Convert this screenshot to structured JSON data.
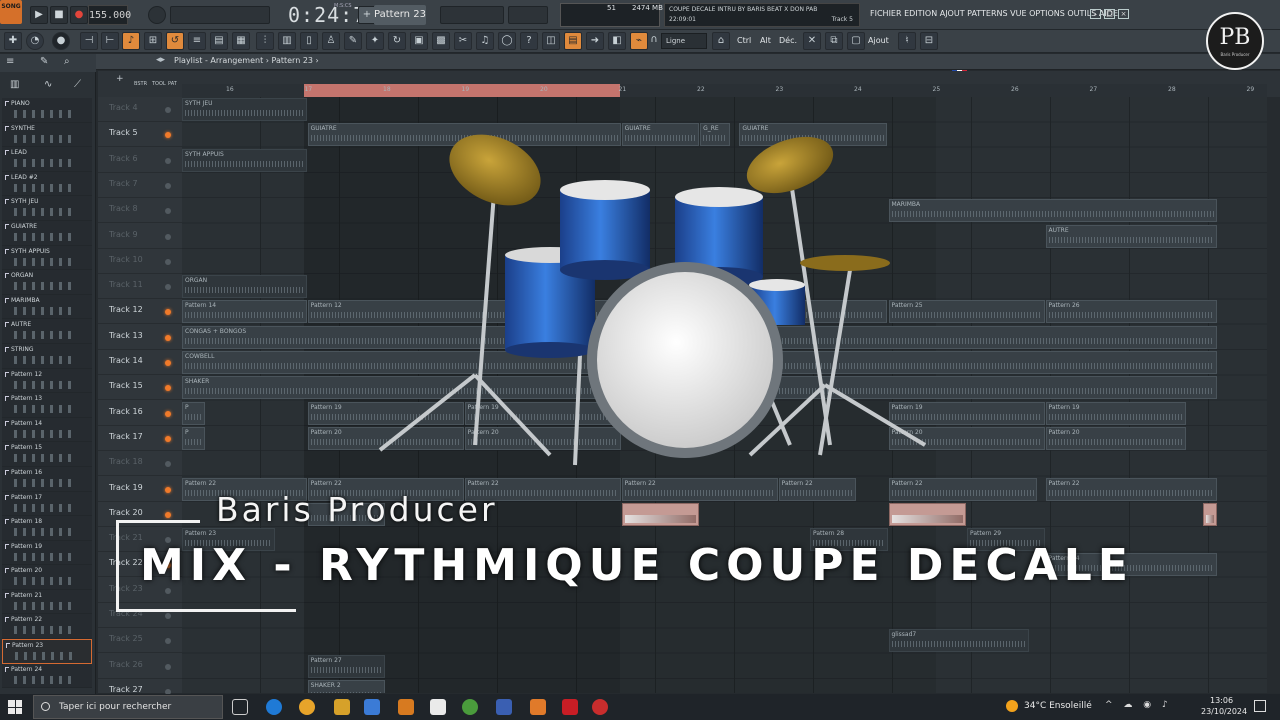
{
  "topbar": {
    "song_badge": "SONG",
    "tempo": "155.000",
    "timer": "0:24:77",
    "timer_unit": "M:S:CS",
    "pattern": "Pattern 23",
    "cpu": "51",
    "memory": "2474 MB",
    "cpu_zero": "0",
    "hint_line1": "COUPE DECALE INTRU BY BARIS BEAT X DON PAB",
    "hint_time": "22:09:01",
    "hint_track": "Track 5",
    "menu": "FICHIER EDITION AJOUT PATTERNS VUE OPTIONS OUTILS AIDE"
  },
  "toolrow": {
    "snap": "Ligne",
    "ctrl": "Ctrl",
    "alt": "Alt",
    "dec": "Déc.",
    "ajout": "Ajout"
  },
  "logo": {
    "text": "PB",
    "sub": "Baris Producer"
  },
  "browser": {
    "items": [
      "PIANO",
      "SYNTHE",
      "LEAD",
      "LEAD #2",
      "SYTH JEU",
      "GUIATRE",
      "SYTH APPUIS",
      "ORGAN",
      "MARIMBA",
      "AUTRE",
      "STRING",
      "Pattern 12",
      "Pattern 13",
      "Pattern 14",
      "Pattern 15",
      "Pattern 16",
      "Pattern 17",
      "Pattern 18",
      "Pattern 19",
      "Pattern 20",
      "Pattern 21",
      "Pattern 22",
      "Pattern 23",
      "Pattern 24"
    ],
    "selected": "Pattern 23"
  },
  "playlist": {
    "title": "Playlist - Arrangement › Pattern 23 ›",
    "tools": [
      "BSTR",
      "TOOL",
      "PAT"
    ],
    "bars": [
      "16",
      "17",
      "18",
      "19",
      "20",
      "21",
      "22",
      "23",
      "24",
      "25",
      "26",
      "27",
      "28",
      "29"
    ],
    "tracks": [
      {
        "label": "Track 4",
        "muted": true,
        "led": false
      },
      {
        "label": "Track 5",
        "muted": false,
        "led": true
      },
      {
        "label": "Track 6",
        "muted": true,
        "led": false
      },
      {
        "label": "Track 7",
        "muted": true,
        "led": false
      },
      {
        "label": "Track 8",
        "muted": true,
        "led": false
      },
      {
        "label": "Track 9",
        "muted": true,
        "led": false
      },
      {
        "label": "Track 10",
        "muted": true,
        "led": false
      },
      {
        "label": "Track 11",
        "muted": true,
        "led": false
      },
      {
        "label": "Track 12",
        "muted": false,
        "led": true
      },
      {
        "label": "Track 13",
        "muted": false,
        "led": true
      },
      {
        "label": "Track 14",
        "muted": false,
        "led": true
      },
      {
        "label": "Track 15",
        "muted": false,
        "led": true
      },
      {
        "label": "Track 16",
        "muted": false,
        "led": true
      },
      {
        "label": "Track 17",
        "muted": false,
        "led": true
      },
      {
        "label": "Track 18",
        "muted": true,
        "led": false
      },
      {
        "label": "Track 19",
        "muted": false,
        "led": true
      },
      {
        "label": "Track 20",
        "muted": false,
        "led": true
      },
      {
        "label": "Track 21",
        "muted": true,
        "led": false
      },
      {
        "label": "Track 22",
        "muted": false,
        "led": true
      },
      {
        "label": "Track 23",
        "muted": true,
        "led": false
      },
      {
        "label": "Track 24",
        "muted": true,
        "led": false
      },
      {
        "label": "Track 25",
        "muted": true,
        "led": false
      },
      {
        "label": "Track 26",
        "muted": true,
        "led": false
      },
      {
        "label": "Track 27",
        "muted": false,
        "led": false
      }
    ],
    "clips": [
      {
        "track": 0,
        "start": 16,
        "len": 1.6,
        "name": "SYTH JEU",
        "dim": true
      },
      {
        "track": 1,
        "start": 17.6,
        "len": 4,
        "name": "GUIATRE"
      },
      {
        "track": 1,
        "start": 21.6,
        "len": 1,
        "name": "GUIATRE"
      },
      {
        "track": 1,
        "start": 22.6,
        "len": 0.4,
        "name": "G_RE"
      },
      {
        "track": 1,
        "start": 23.1,
        "len": 1.9,
        "name": "GUIATRE"
      },
      {
        "track": 2,
        "start": 16,
        "len": 1.6,
        "name": "SYTH APPUIS",
        "dim": true
      },
      {
        "track": 4,
        "start": 25,
        "len": 4.2,
        "name": "MARIMBA"
      },
      {
        "track": 5,
        "start": 27,
        "len": 2.2,
        "name": "AUTRE"
      },
      {
        "track": 7,
        "start": 16,
        "len": 1.6,
        "name": "ORGAN",
        "dim": true
      },
      {
        "track": 8,
        "start": 16,
        "len": 1.6,
        "name": "Pattern 14"
      },
      {
        "track": 8,
        "start": 17.6,
        "len": 7.4,
        "name": "Pattern 12"
      },
      {
        "track": 8,
        "start": 25,
        "len": 2,
        "name": "Pattern 25"
      },
      {
        "track": 8,
        "start": 27,
        "len": 2.2,
        "name": "Pattern 26"
      },
      {
        "track": 9,
        "start": 16,
        "len": 13.2,
        "name": "CONGAS + BONGOS"
      },
      {
        "track": 10,
        "start": 16,
        "len": 13.2,
        "name": "COWBELL"
      },
      {
        "track": 11,
        "start": 16,
        "len": 13.2,
        "name": "SHAKER"
      },
      {
        "track": 12,
        "start": 16,
        "len": 0.3,
        "name": "P"
      },
      {
        "track": 12,
        "start": 17.6,
        "len": 2,
        "name": "Pattern 19"
      },
      {
        "track": 12,
        "start": 19.6,
        "len": 2,
        "name": "Pattern 19"
      },
      {
        "track": 12,
        "start": 25,
        "len": 2,
        "name": "Pattern 19"
      },
      {
        "track": 12,
        "start": 27,
        "len": 1.8,
        "name": "Pattern 19"
      },
      {
        "track": 13,
        "start": 16,
        "len": 0.3,
        "name": "P"
      },
      {
        "track": 13,
        "start": 17.6,
        "len": 2,
        "name": "Pattern 20"
      },
      {
        "track": 13,
        "start": 19.6,
        "len": 2,
        "name": "Pattern 20"
      },
      {
        "track": 13,
        "start": 25,
        "len": 2,
        "name": "Pattern 20"
      },
      {
        "track": 13,
        "start": 27,
        "len": 1.8,
        "name": "Pattern 20"
      },
      {
        "track": 15,
        "start": 16,
        "len": 1.6,
        "name": "Pattern 22"
      },
      {
        "track": 15,
        "start": 17.6,
        "len": 2,
        "name": "Pattern 22"
      },
      {
        "track": 15,
        "start": 19.6,
        "len": 2,
        "name": "Pattern 22"
      },
      {
        "track": 15,
        "start": 21.6,
        "len": 2,
        "name": "Pattern 22"
      },
      {
        "track": 15,
        "start": 23.6,
        "len": 1,
        "name": "Pattern 22"
      },
      {
        "track": 15,
        "start": 25,
        "len": 1.9,
        "name": "Pattern 22"
      },
      {
        "track": 15,
        "start": 27,
        "len": 2.2,
        "name": "Pattern 22"
      },
      {
        "track": 16,
        "start": 17.6,
        "len": 1,
        "name": ""
      },
      {
        "track": 16,
        "start": 21.6,
        "len": 1,
        "name": "",
        "pink": true
      },
      {
        "track": 16,
        "start": 25,
        "len": 1,
        "name": "",
        "pink": true
      },
      {
        "track": 16,
        "start": 29,
        "len": 0.2,
        "name": "",
        "pink": true
      },
      {
        "track": 17,
        "start": 16,
        "len": 1.2,
        "name": "Pattern 23",
        "dim": true
      },
      {
        "track": 17,
        "start": 24,
        "len": 1,
        "name": "Pattern 28",
        "dim": true
      },
      {
        "track": 17,
        "start": 26,
        "len": 1,
        "name": "Pattern 29",
        "dim": true
      },
      {
        "track": 18,
        "start": 27,
        "len": 2.2,
        "name": "Pattern 24"
      },
      {
        "track": 21,
        "start": 25,
        "len": 1.8,
        "name": "glissad7",
        "dim": true
      },
      {
        "track": 22,
        "start": 17.6,
        "len": 1,
        "name": "Pattern 27",
        "dim": true
      },
      {
        "track": 23,
        "start": 17.6,
        "len": 1,
        "name": "SHAKER 2"
      }
    ]
  },
  "overlay": {
    "subtitle": "Baris Producer",
    "title": "MIX - RYTHMIQUE COUPE DECALE"
  },
  "taskbar": {
    "search_placeholder": "Taper ici pour rechercher",
    "weather": "34°C  Ensoleillé",
    "time": "13:06",
    "date": "23/10/2024"
  },
  "colors": {
    "accent": "#e08a3c",
    "loop": "#c4746d",
    "led": "#f07a2a"
  }
}
